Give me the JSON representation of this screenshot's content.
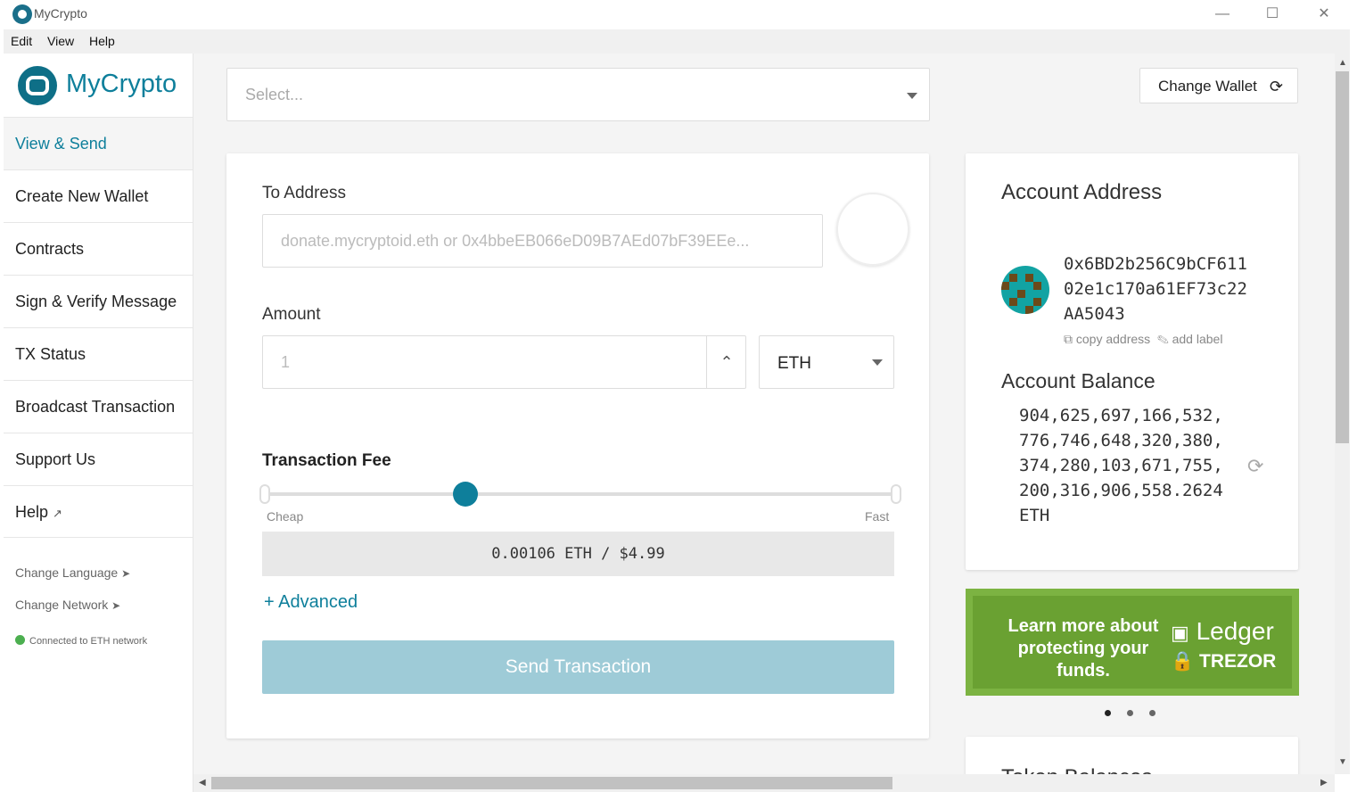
{
  "window": {
    "title": "MyCrypto",
    "minimize": "—",
    "maximize": "☐",
    "close": "✕"
  },
  "menu": [
    "Edit",
    "View",
    "Help"
  ],
  "brand": {
    "name": "MyCrypto",
    "accent": "#0e7f9b"
  },
  "sidebar": {
    "items": [
      {
        "label": "View & Send",
        "active": true
      },
      {
        "label": "Create New Wallet"
      },
      {
        "label": "Contracts"
      },
      {
        "label": "Sign & Verify Message"
      },
      {
        "label": "TX Status"
      },
      {
        "label": "Broadcast Transaction"
      },
      {
        "label": "Support Us"
      },
      {
        "label": "Help"
      }
    ],
    "change_language": "Change Language",
    "change_network": "Change Network",
    "connection": "Connected to ETH network"
  },
  "wallet_select": {
    "placeholder": "Select..."
  },
  "change_wallet": {
    "label": "Change Wallet"
  },
  "form": {
    "to_address_label": "To Address",
    "to_address_placeholder": "donate.mycryptoid.eth or 0x4bbeEB066eD09B7AEd07bF39EEe...",
    "amount_label": "Amount",
    "amount_placeholder": "1",
    "unit": "ETH",
    "fee_label": "Transaction Fee",
    "fee_cheap": "Cheap",
    "fee_fast": "Fast",
    "fee_value": "0.00106 ETH / $4.99",
    "advanced": "+ Advanced",
    "send": "Send Transaction"
  },
  "account": {
    "address_title": "Account Address",
    "address": "0x6BD2b256C9bCF61102e1c170a61EF73c22AA5043",
    "copy_address": "copy address",
    "add_label": "add label",
    "balance_title": "Account Balance",
    "balance": "904,625,697,166,532,776,746,648,320,380,374,280,103,671,755,200,316,906,558.2624 ETH"
  },
  "banner": {
    "text": "Learn more about protecting your funds.",
    "ledger": "Ledger",
    "trezor": "TREZOR",
    "bg_color": "#7cb342"
  },
  "token_balances_partial": "Token Balances"
}
